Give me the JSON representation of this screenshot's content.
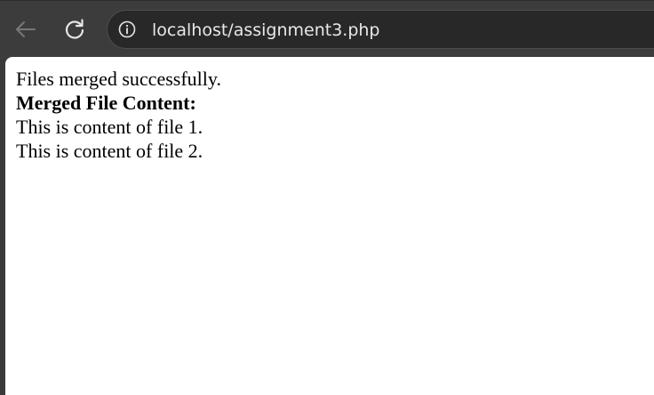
{
  "browser": {
    "url": "localhost/assignment3.php"
  },
  "page": {
    "status_message": "Files merged successfully.",
    "heading": "Merged File Content:",
    "lines": [
      "This is content of file 1.",
      "This is content of file 2."
    ]
  },
  "icons": {
    "back": "back-arrow-icon",
    "reload": "reload-icon",
    "info": "info-icon"
  }
}
